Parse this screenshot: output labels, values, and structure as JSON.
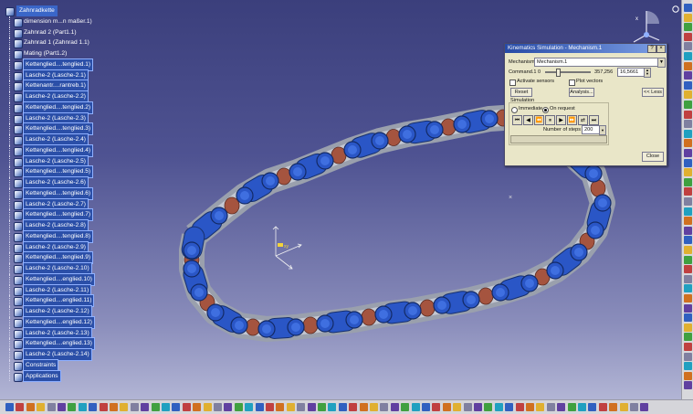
{
  "tree": {
    "root": "Zahnradkette",
    "items": [
      "dimension m...n maßer.1)",
      "Zahnrad 2 (Part1.1)",
      "Zahnrad 1 (Zahnrad 1.1)",
      "Mating (Part1.2)",
      "Kettenglied....tenglied.1)",
      "Lasche-2 (Lasche-2.1)",
      "Kettenantr....rantreb.1)",
      "Lasche-2 (Lasche-2.2)",
      "Kettenglied....tenglied.2)",
      "Lasche-2 (Lasche-2.3)",
      "Kettenglied....tenglied.3)",
      "Lasche-2 (Lasche-2.4)",
      "Kettenglied....tenglied.4)",
      "Lasche-2 (Lasche-2.5)",
      "Kettenglied....tenglied.5)",
      "Lasche-2 (Lasche-2.6)",
      "Kettenglied....tenglied.6)",
      "Lasche-2 (Lasche-2.7)",
      "Kettenglied....tenglied.7)",
      "Lasche-2 (Lasche-2.8)",
      "Kettenglied....tenglied.8)",
      "Lasche-2 (Lasche-2.9)",
      "Kettenglied....tenglied.9)",
      "Lasche-2 (Lasche-2.10)",
      "Kettenglied....englied.10)",
      "Lasche-2 (Lasche-2.11)",
      "Kettenglied....englied.11)",
      "Lasche-2 (Lasche-2.12)",
      "Kettenglied....englied.12)",
      "Lasche-2 (Lasche-2.13)",
      "Kettenglied....englied.13)",
      "Lasche-2 (Lasche-2.14)",
      "Constraints",
      "Applications"
    ]
  },
  "dialog": {
    "title": "Kinematics Simulation - Mechanism.1",
    "mechanism_label": "Mechanism :",
    "mechanism_value": "Mechanism.1",
    "command_label": "Command.1",
    "command_min": "0",
    "command_max": "357,256",
    "command_value": "16,5661",
    "activate_sensors": "Activate sensors",
    "plot_vectors": "Plot vectors",
    "reset_label": "Reset",
    "analysis_label": "Analysis...",
    "less_label": "<< Less",
    "simulation_label": "Simulation",
    "immediate_label": "Immediate",
    "on_request_label": "On request",
    "steps_label": "Number of steps",
    "steps_value": "200",
    "close_label": "Close"
  },
  "colors": {
    "link_blue": "#2a56c6",
    "plate_silver": "#9aa0ad",
    "roller_copper": "#a5543f",
    "background_top": "#3b3f7c",
    "background_bottom": "#b9bcd9"
  }
}
